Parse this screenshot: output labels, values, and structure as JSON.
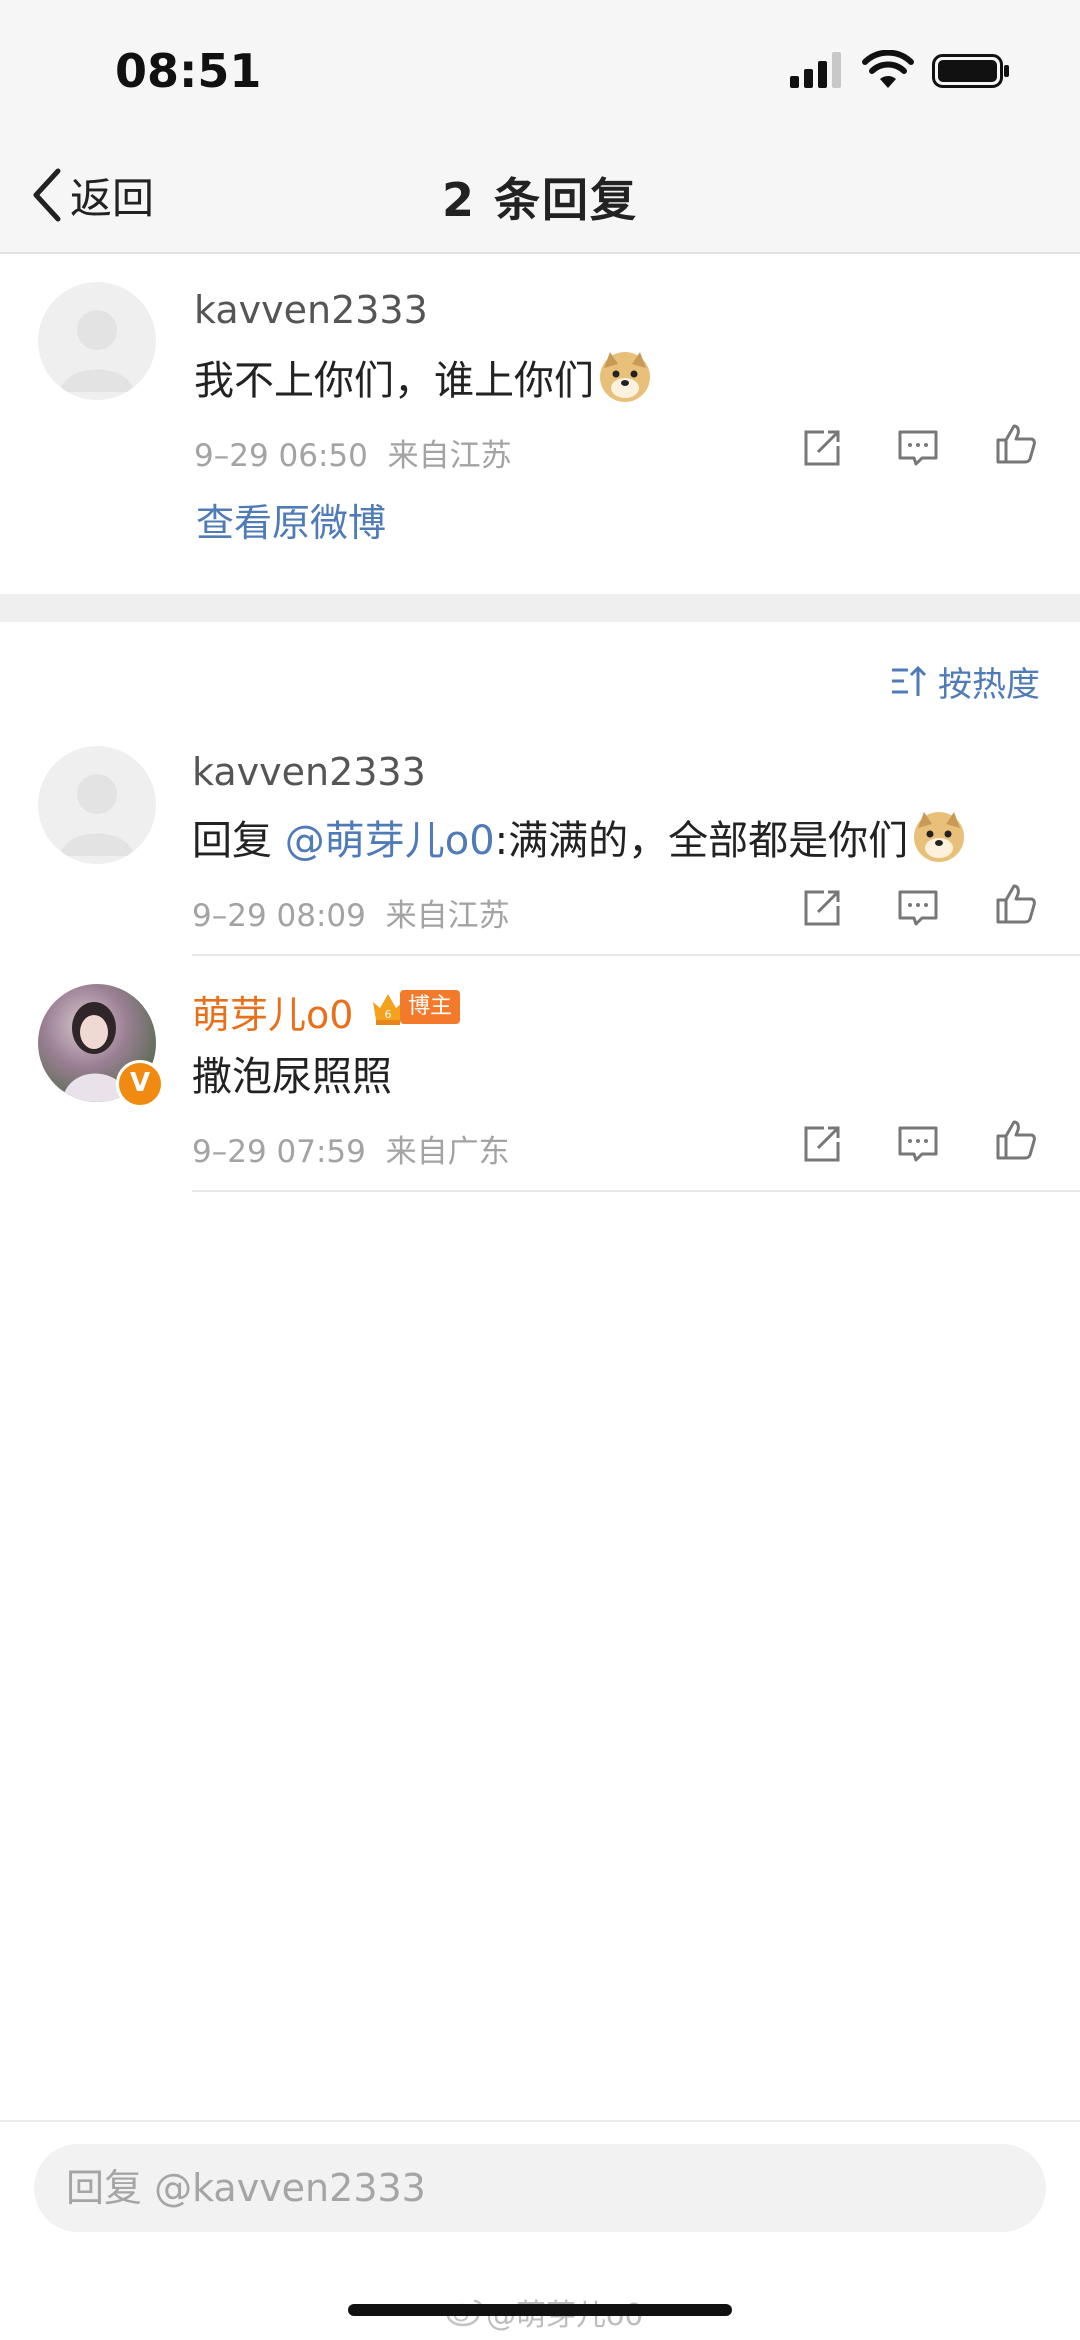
{
  "status_bar": {
    "time": "08:51"
  },
  "nav": {
    "back_label": "返回",
    "title": "2 条回复"
  },
  "root_post": {
    "author": "kavven2333",
    "content": "我不上你们，谁上你们",
    "timestamp": "9–29 06:50",
    "location": "来自江苏",
    "view_original": "查看原微博"
  },
  "sort": {
    "label": "按热度"
  },
  "replies": [
    {
      "author": "kavven2333",
      "reply_prefix": "回复 ",
      "mention": "@萌芽儿o0",
      "content": ":满满的，全部都是你们",
      "timestamp": "9–29 08:09",
      "location": "来自江苏"
    },
    {
      "author": "萌芽儿o0",
      "badge": "博主",
      "avatar_badge": "V",
      "content": "撒泡尿照照",
      "timestamp": "9–29 07:59",
      "location": "来自广东"
    }
  ],
  "bottom": {
    "reply_placeholder": "回复 @kavven2333",
    "watermark": "@萌芽儿o0"
  },
  "colors": {
    "link": "#4f7bb8",
    "vip_name": "#e8701a",
    "badge": "#f47a2b"
  }
}
